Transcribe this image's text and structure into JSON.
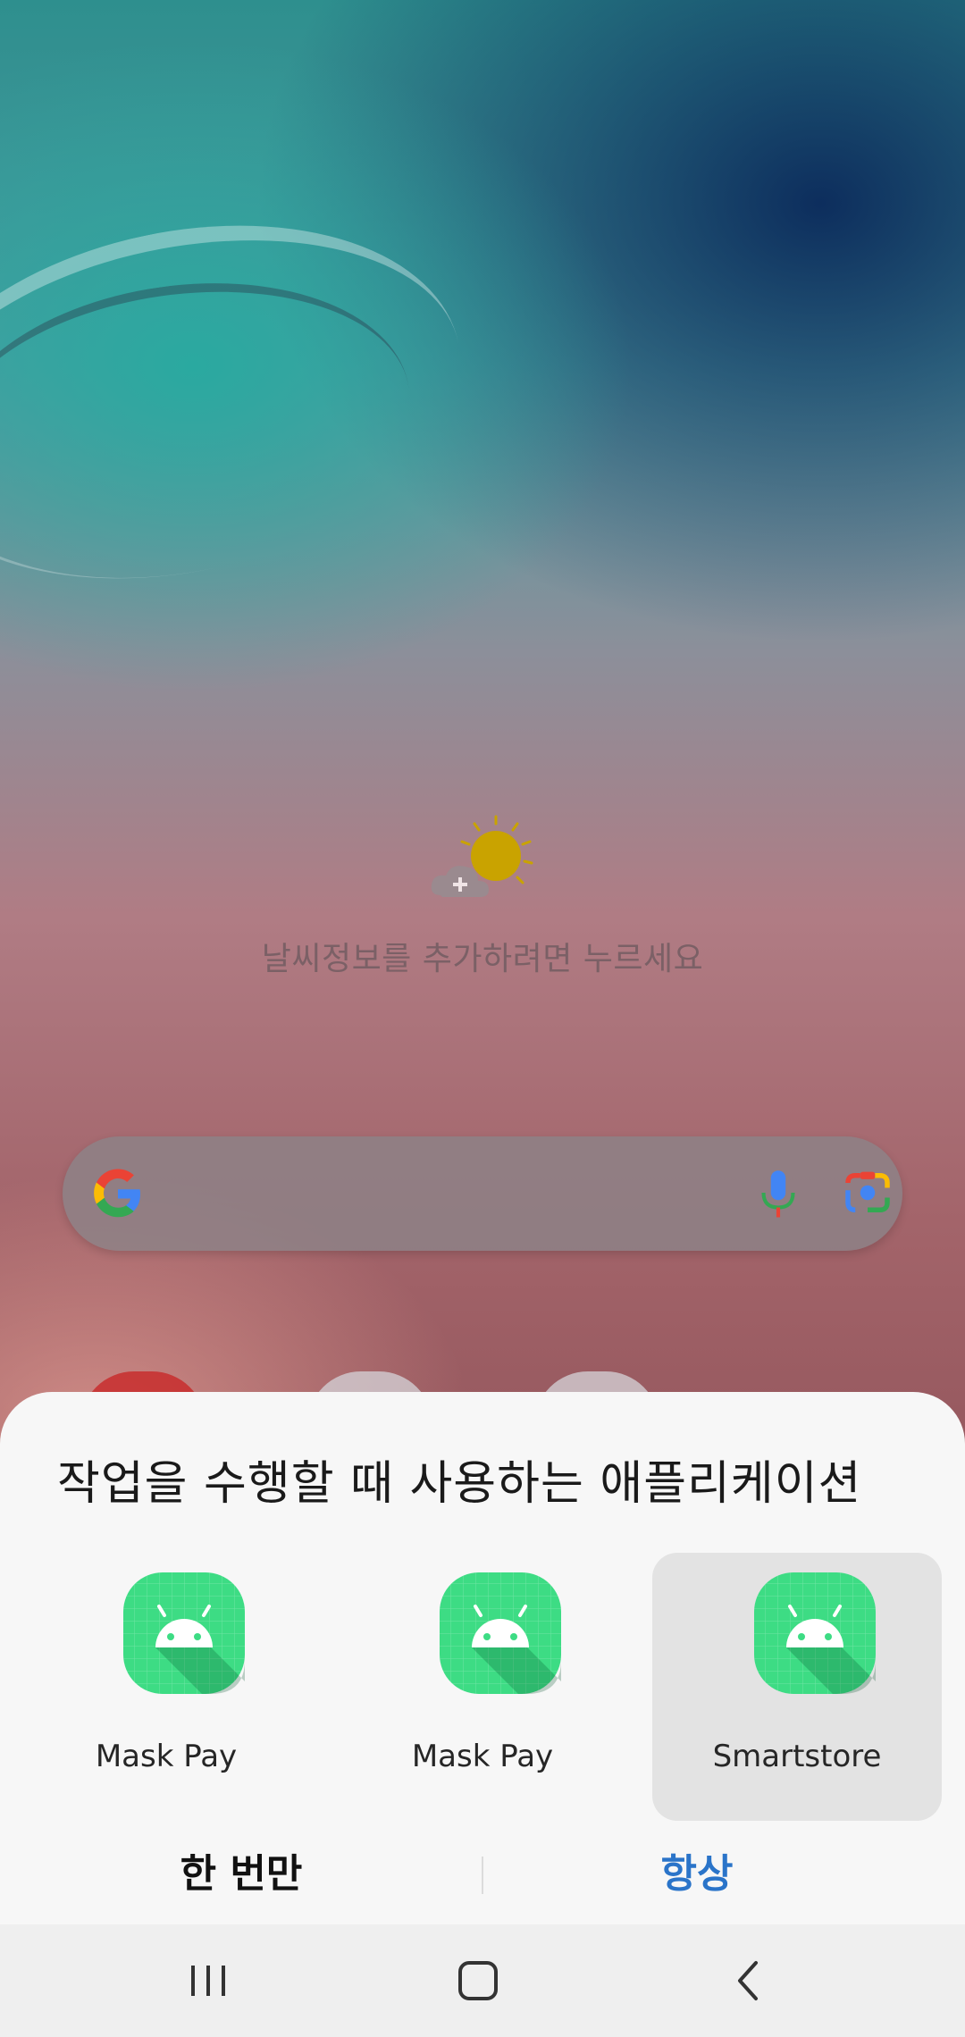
{
  "weather": {
    "prompt": "날씨정보를 추가하려면 누르세요",
    "icon": "weather-add-icon"
  },
  "search_bar": {
    "logo_icon": "google-g-icon",
    "mic_icon": "microphone-icon",
    "lens_icon": "google-lens-icon"
  },
  "chooser": {
    "title": "작업을 수행할 때 사용하는 애플리케이션",
    "apps": [
      {
        "label": "Mask Pay",
        "icon": "android-app-icon",
        "selected": false
      },
      {
        "label": "Mask Pay",
        "icon": "android-app-icon",
        "selected": false
      },
      {
        "label": "Smartstore",
        "icon": "android-app-icon",
        "selected": true
      }
    ],
    "just_once_label": "한 번만",
    "always_label": "항상",
    "accent_color": "#2a74c9"
  },
  "navigation": {
    "recents_icon": "recents-icon",
    "home_icon": "home-icon",
    "back_icon": "back-icon"
  }
}
